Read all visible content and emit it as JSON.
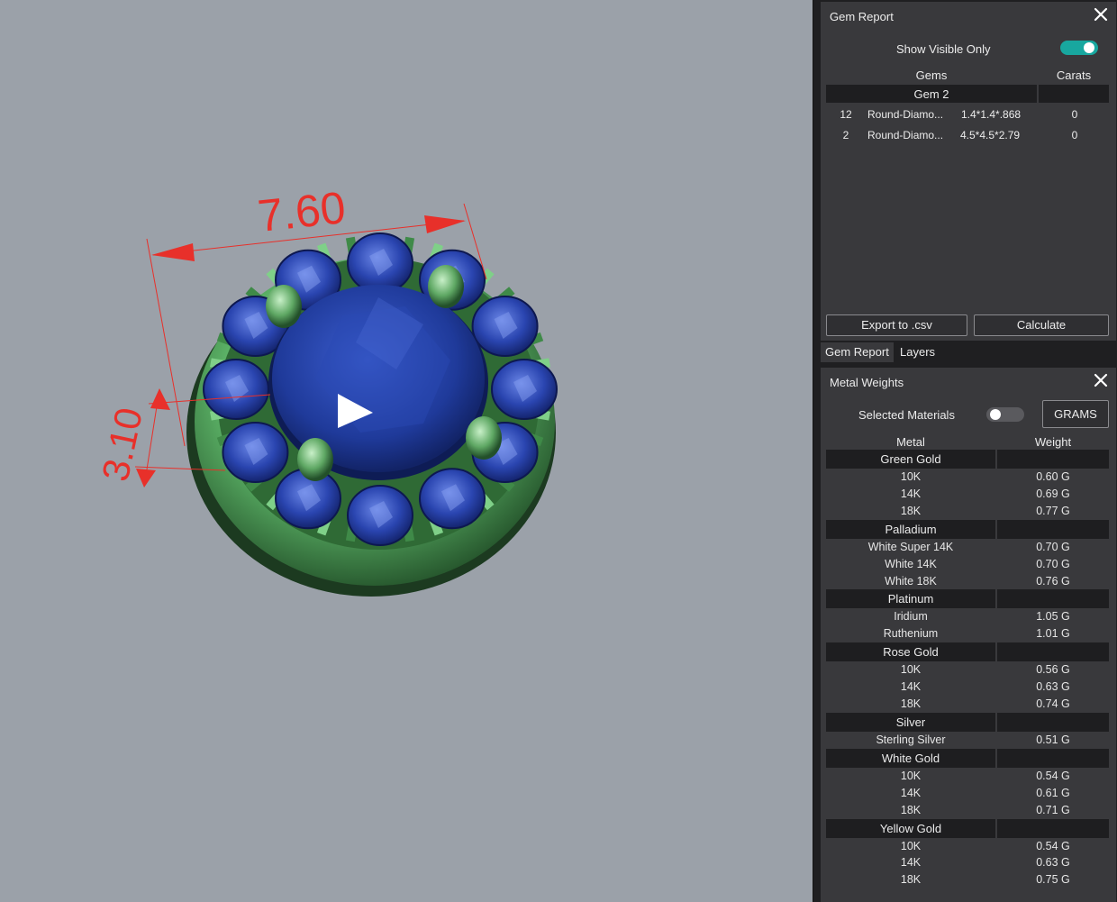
{
  "viewport": {
    "dimension_width": "7.60",
    "dimension_height": "3.10",
    "colors": {
      "background": "#9ba1a9",
      "metal": "#5fb86a",
      "gem": "#1f3a9a",
      "dimension": "#e8302a"
    }
  },
  "gem_report": {
    "title": "Gem Report",
    "show_visible_only_label": "Show Visible Only",
    "show_visible_only": true,
    "columns": {
      "gems": "Gems",
      "carats": "Carats"
    },
    "group_name": "Gem 2",
    "rows": [
      {
        "count": "12",
        "name": "Round-Diamo...",
        "size": "1.4*1.4*.868",
        "carats": "0"
      },
      {
        "count": "2",
        "name": "Round-Diamo...",
        "size": "4.5*4.5*2.79",
        "carats": "0"
      }
    ],
    "export_label": "Export to .csv",
    "calculate_label": "Calculate"
  },
  "tabs": {
    "gem_report": "Gem Report",
    "layers": "Layers"
  },
  "metal_weights": {
    "title": "Metal Weights",
    "selected_materials_label": "Selected Materials",
    "selected_materials": false,
    "units_label": "GRAMS",
    "columns": {
      "metal": "Metal",
      "weight": "Weight"
    },
    "groups": [
      {
        "name": "Green Gold",
        "items": [
          {
            "name": "10K",
            "weight": "0.60 G"
          },
          {
            "name": "14K",
            "weight": "0.69 G"
          },
          {
            "name": "18K",
            "weight": "0.77 G"
          }
        ]
      },
      {
        "name": "Palladium",
        "items": [
          {
            "name": "White Super 14K",
            "weight": "0.70 G"
          },
          {
            "name": "White 14K",
            "weight": "0.70 G"
          },
          {
            "name": "White 18K",
            "weight": "0.76 G"
          }
        ]
      },
      {
        "name": "Platinum",
        "items": [
          {
            "name": "Iridium",
            "weight": "1.05 G"
          },
          {
            "name": "Ruthenium",
            "weight": "1.01 G"
          }
        ]
      },
      {
        "name": "Rose Gold",
        "items": [
          {
            "name": "10K",
            "weight": "0.56 G"
          },
          {
            "name": "14K",
            "weight": "0.63 G"
          },
          {
            "name": "18K",
            "weight": "0.74 G"
          }
        ]
      },
      {
        "name": "Silver",
        "items": [
          {
            "name": "Sterling Silver",
            "weight": "0.51 G"
          }
        ]
      },
      {
        "name": "White Gold",
        "items": [
          {
            "name": "10K",
            "weight": "0.54 G"
          },
          {
            "name": "14K",
            "weight": "0.61 G"
          },
          {
            "name": "18K",
            "weight": "0.71 G"
          }
        ]
      },
      {
        "name": "Yellow Gold",
        "items": [
          {
            "name": "10K",
            "weight": "0.54 G"
          },
          {
            "name": "14K",
            "weight": "0.63 G"
          },
          {
            "name": "18K",
            "weight": "0.75 G"
          }
        ]
      }
    ]
  }
}
